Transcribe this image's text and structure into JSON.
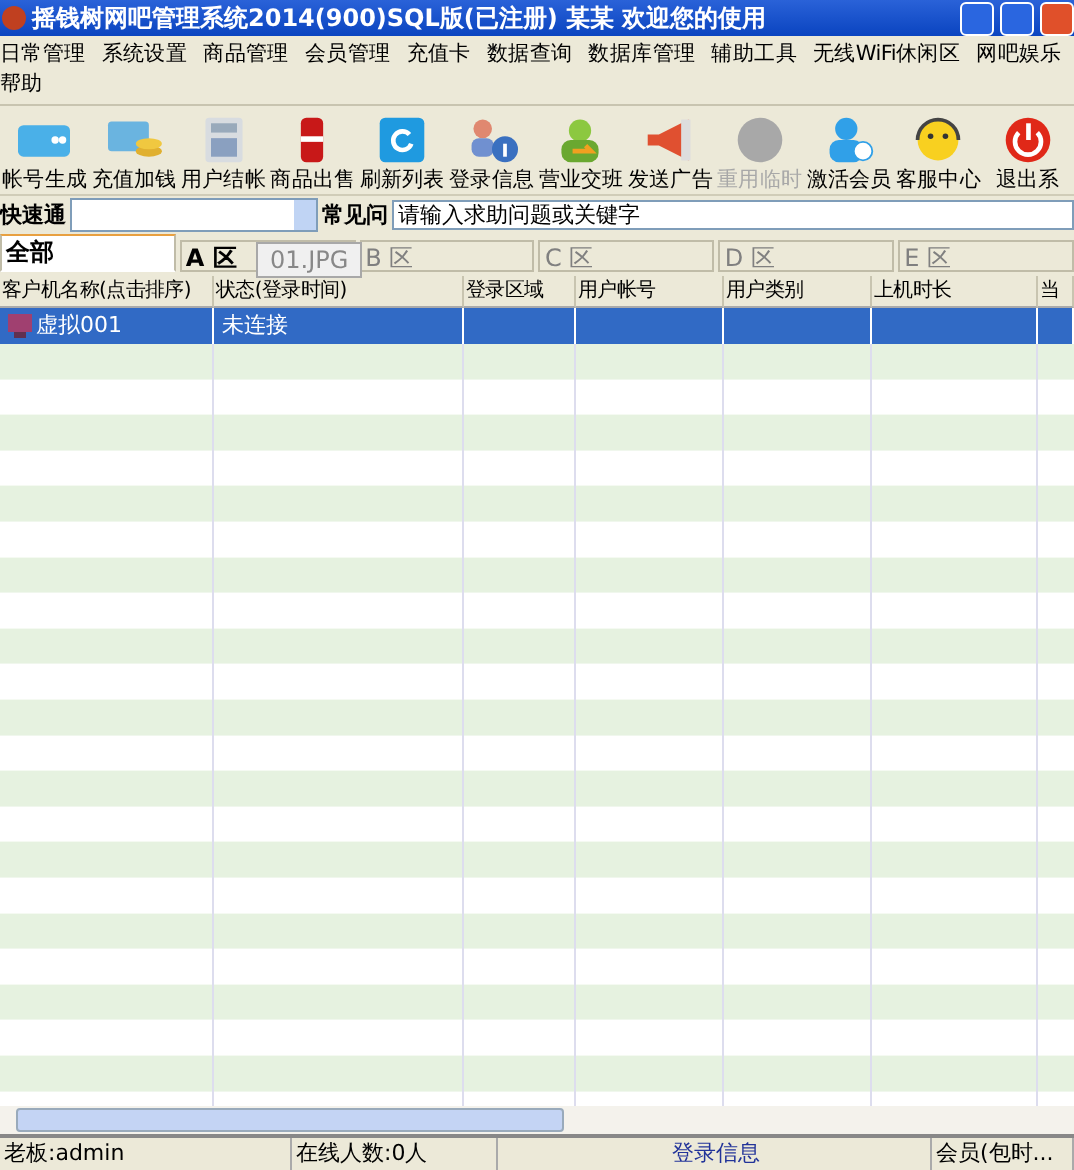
{
  "window": {
    "title": "摇钱树网吧管理系统2014(900)SQL版(已注册)   某某 欢迎您的使用"
  },
  "menu": [
    "日常管理",
    "系统设置",
    "商品管理",
    "会员管理",
    "充值卡",
    "数据查询",
    "数据库管理",
    "辅助工具",
    "无线WiFi休闲区",
    "网吧娱乐",
    "帮助"
  ],
  "toolbar": [
    {
      "label": "帐号生成",
      "disabled": false
    },
    {
      "label": "充值加钱",
      "disabled": false
    },
    {
      "label": "用户结帐",
      "disabled": false
    },
    {
      "label": "商品出售",
      "disabled": false
    },
    {
      "label": "刷新列表",
      "disabled": false
    },
    {
      "label": "登录信息",
      "disabled": false
    },
    {
      "label": "营业交班",
      "disabled": false
    },
    {
      "label": "发送广告",
      "disabled": false
    },
    {
      "label": "重用临时",
      "disabled": true
    },
    {
      "label": "激活会员",
      "disabled": false
    },
    {
      "label": "客服中心",
      "disabled": false
    },
    {
      "label": "退出系",
      "disabled": false
    }
  ],
  "quick_access": {
    "label": "快速通"
  },
  "faq": {
    "label": "常见问",
    "placeholder": "请输入求助问题或关键字"
  },
  "zone_tabs": [
    {
      "label": "全部",
      "selected": true,
      "disabled": false
    },
    {
      "label": "A 区",
      "selected": false,
      "disabled": false
    },
    {
      "label": "B 区",
      "selected": false,
      "disabled": true
    },
    {
      "label": "C 区",
      "selected": false,
      "disabled": true
    },
    {
      "label": "D 区",
      "selected": false,
      "disabled": true
    },
    {
      "label": "E 区",
      "selected": false,
      "disabled": true
    }
  ],
  "drag_tooltip": "01.JPG",
  "table": {
    "columns": [
      "客户机名称(点击排序)",
      "状态(登录时间)",
      "登录区域",
      "用户帐号",
      "用户类别",
      "上机时长",
      "当"
    ],
    "rows": [
      {
        "cells": [
          "虚拟001",
          "未连接",
          "",
          "",
          "",
          "",
          ""
        ],
        "selected": true
      }
    ]
  },
  "status_bar": [
    "老板:admin",
    "在线人数:0人",
    "登录信息",
    "会员(包时..."
  ]
}
